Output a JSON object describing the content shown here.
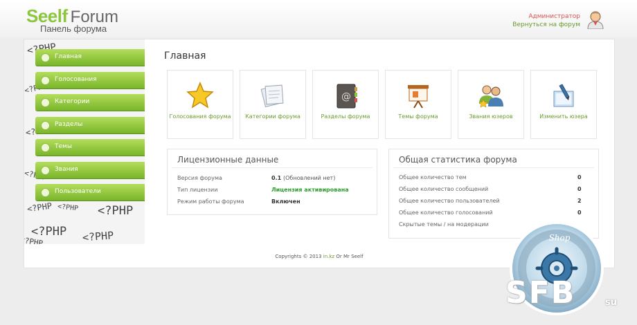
{
  "header": {
    "logo_word1": "Seelf",
    "logo_word2": "Forum",
    "subtitle": "Панель форума",
    "admin_link": "Администратор",
    "back_link": "Вернуться на форум"
  },
  "sidebar": {
    "bg_text": "<?PHP",
    "items": [
      {
        "label": "Главная"
      },
      {
        "label": "Голосования"
      },
      {
        "label": "Категории"
      },
      {
        "label": "Разделы"
      },
      {
        "label": "Темы"
      },
      {
        "label": "Звания"
      },
      {
        "label": "Пользователи"
      }
    ]
  },
  "main": {
    "title": "Главная",
    "tiles": [
      {
        "label": "Голосования форума",
        "icon": "star-icon"
      },
      {
        "label": "Категории форума",
        "icon": "papers-icon"
      },
      {
        "label": "Разделы форума",
        "icon": "address-book-icon"
      },
      {
        "label": "Темы форума",
        "icon": "presentation-board-icon"
      },
      {
        "label": "Звания юзеров",
        "icon": "users-icon"
      },
      {
        "label": "Изменить юзера",
        "icon": "edit-user-icon"
      }
    ]
  },
  "license": {
    "title": "Лицензионные данные",
    "rows": [
      {
        "label": "Версия форума",
        "value": "0.1",
        "note": "(Обновлений нет)"
      },
      {
        "label": "Тип лицензии",
        "value": "Лицензия активирована"
      },
      {
        "label": "Режим работы форума",
        "value": "Включен"
      }
    ]
  },
  "stats": {
    "title": "Общая статистика форума",
    "rows": [
      {
        "label": "Общее количество тем",
        "value": "0"
      },
      {
        "label": "Общее количество сообщений",
        "value": "0"
      },
      {
        "label": "Общее количество пользователей",
        "value": "2"
      },
      {
        "label": "Общее количество голосований",
        "value": "0"
      },
      {
        "label": "Скрытые темы / на модерации",
        "value": ""
      }
    ]
  },
  "footer": {
    "copy_prefix": "Copyrights © 2013",
    "copy_link": "in.kz",
    "copy_suffix": "Or Mr Seelf"
  },
  "watermark": {
    "ring_text": "Shop",
    "brand": "SFB",
    "tld": "su"
  },
  "colors": {
    "brand_green": "#8cc63f",
    "menu_green": "#78b52a",
    "link_red": "#d9534f",
    "link_green": "#6a9a2b"
  }
}
